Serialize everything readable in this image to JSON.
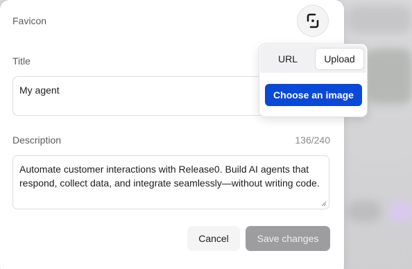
{
  "favicon": {
    "label": "Favicon",
    "icon": "release0-logo-icon"
  },
  "title_field": {
    "label": "Title",
    "value": "My agent"
  },
  "description_field": {
    "label": "Description",
    "counter": "136/240",
    "value": "Automate customer interactions with Release0. Build AI agents that respond, collect data, and integrate seamlessly—without writing code."
  },
  "actions": {
    "cancel_label": "Cancel",
    "save_label": "Save changes"
  },
  "favicon_popover": {
    "tabs": [
      {
        "label": "URL",
        "selected": false
      },
      {
        "label": "Upload",
        "selected": true
      }
    ],
    "choose_label": "Choose an image"
  },
  "colors": {
    "primary": "#0a49d6",
    "save_disabled": "#9d9d9f"
  }
}
